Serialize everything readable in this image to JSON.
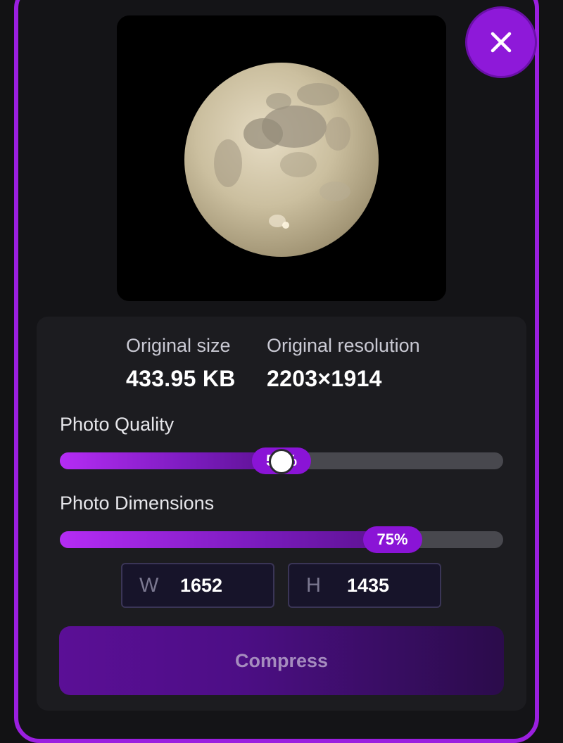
{
  "close_button": {
    "icon": "close-icon"
  },
  "preview": {
    "image": "full-moon-photo"
  },
  "info": {
    "original_size_label": "Original size",
    "original_size_value": "433.95 KB",
    "original_resolution_label": "Original resolution",
    "original_resolution_value": "2203×1914"
  },
  "quality": {
    "label": "Photo Quality",
    "value_text": "50%",
    "value": 0.5
  },
  "dimensions": {
    "label": "Photo Dimensions",
    "value_text": "75%",
    "value": 0.75,
    "width_prefix": "W",
    "width_value": "1652",
    "height_prefix": "H",
    "height_value": "1435"
  },
  "compress_button": {
    "label": "Compress"
  },
  "colors": {
    "accent": "#8e19d9",
    "border": "#9b1fe0",
    "panel": "#1c1c20",
    "track": "#48484e"
  }
}
